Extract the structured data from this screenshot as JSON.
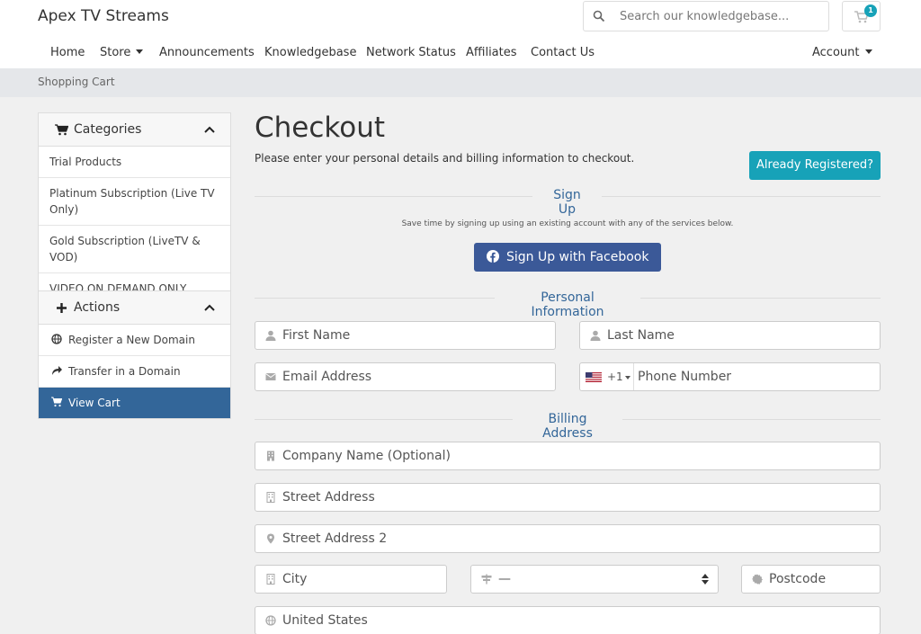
{
  "header": {
    "brand": "Apex TV Streams",
    "search_placeholder": "Search our knowledgebase...",
    "cart_count": "1"
  },
  "nav": {
    "items": [
      "Home",
      "Store",
      "Announcements",
      "Knowledgebase",
      "Network Status",
      "Affiliates",
      "Contact Us"
    ],
    "account": "Account"
  },
  "breadcrumb": "Shopping Cart",
  "sidebar": {
    "categories": {
      "title": "Categories",
      "items": [
        "Trial Products",
        "Platinum Subscription (Live TV Only)",
        "Gold Subscription (LiveTV & VOD)",
        "VIDEO ON DEMAND ONLY"
      ]
    },
    "actions": {
      "title": "Actions",
      "items": [
        "Register a New Domain",
        "Transfer in a Domain",
        "View Cart"
      ]
    }
  },
  "main": {
    "title": "Checkout",
    "subtitle": "Please enter your personal details and billing information to checkout.",
    "already_registered": "Already Registered?",
    "signup": {
      "heading": "Sign Up",
      "note": "Save time by signing up using an existing account with any of the services below.",
      "facebook": "Sign Up with Facebook"
    },
    "personal": {
      "heading": "Personal Information",
      "first_name": "First Name",
      "last_name": "Last Name",
      "email": "Email Address",
      "phone_code": "+1",
      "phone": "Phone Number"
    },
    "billing": {
      "heading": "Billing Address",
      "company": "Company Name (Optional)",
      "street": "Street Address",
      "street2": "Street Address 2",
      "city": "City",
      "state": "—",
      "postcode": "Postcode",
      "country": "United States"
    }
  },
  "colors": {
    "accent": "#336699",
    "info": "#17a2b8",
    "facebook": "#3b5998"
  }
}
